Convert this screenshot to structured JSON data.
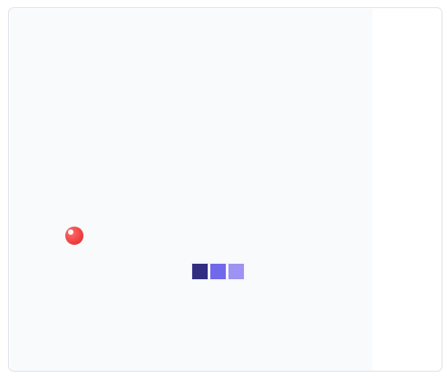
{
  "game": {
    "food": {
      "icon": "apple-dot"
    },
    "snake": {
      "segments": [
        {
          "role": "head",
          "color": "#312e81"
        },
        {
          "role": "body",
          "color": "#7168ec"
        },
        {
          "role": "body",
          "color": "#9d93f2"
        }
      ]
    },
    "colors": {
      "board_bg": "#f8fafc",
      "food": "#ef4444",
      "border": "#dfe3ea"
    }
  }
}
